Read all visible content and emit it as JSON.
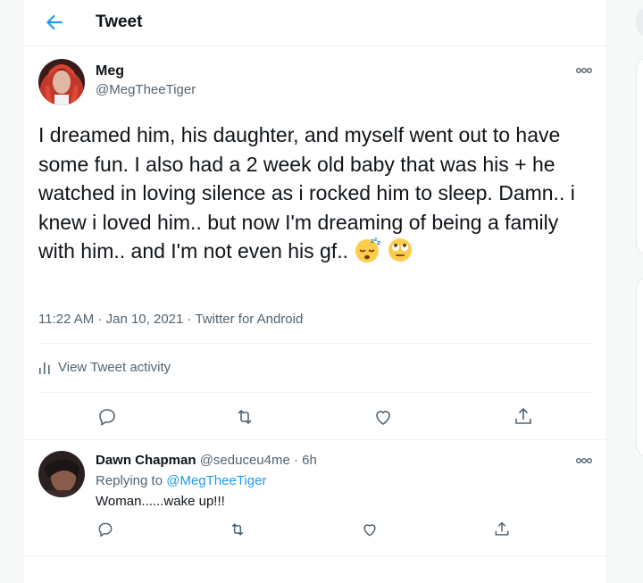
{
  "header": {
    "title": "Tweet"
  },
  "tweet": {
    "author_name": "Meg",
    "author_handle": "@MegTheeTiger",
    "text": "I dreamed him, his daughter, and myself went out to have some fun. I also had a 2 week old baby that was his + he watched in loving silence as i rocked him to sleep. Damn.. i knew i loved him.. but now I'm dreaming of being a family with him.. and I'm not even his gf..",
    "emojis": [
      "sleeping-face-emoji",
      "face-with-rolling-eyes-emoji"
    ],
    "time": "11:22 AM",
    "separator": "·",
    "date": "Jan 10, 2021",
    "source": "Twitter for Android",
    "activity_label": "View Tweet activity"
  },
  "actions": [
    "reply-icon",
    "retweet-icon",
    "like-icon",
    "share-icon"
  ],
  "reply": {
    "name": "Dawn Chapman",
    "handle": "@seduceu4me",
    "separator": "·",
    "time": "6h",
    "replying_prefix": "Replying to",
    "replying_to": "@MegTheeTiger",
    "text": "Woman......wake up!!!"
  },
  "colors": {
    "accent": "#1d9bf0",
    "secondary_text": "#536471",
    "divider": "#eff3f4",
    "emoji": "#ffcc4d"
  }
}
